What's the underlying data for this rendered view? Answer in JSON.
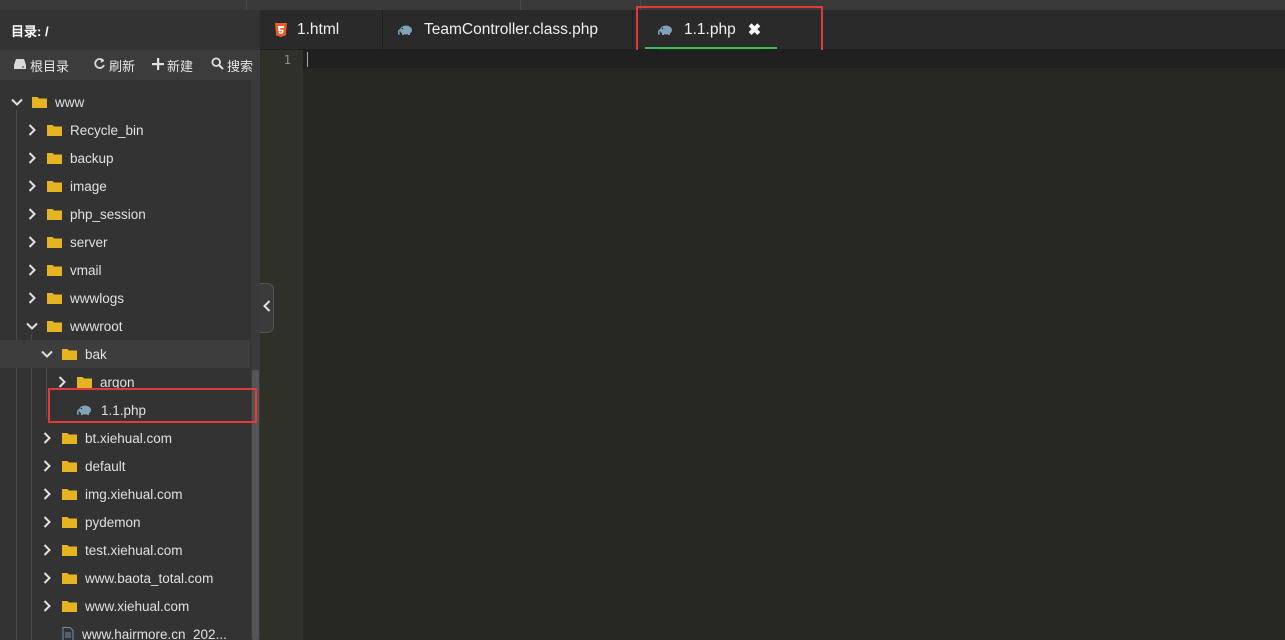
{
  "sidebar": {
    "directory_label": "目录: /",
    "toolbar": {
      "root": "根目录",
      "refresh": "刷新",
      "new": "新建",
      "search": "搜索"
    },
    "tree": [
      {
        "label": "www",
        "depth": 0,
        "type": "folder",
        "expanded": true
      },
      {
        "label": "Recycle_bin",
        "depth": 1,
        "type": "folder",
        "expanded": false
      },
      {
        "label": "backup",
        "depth": 1,
        "type": "folder",
        "expanded": false
      },
      {
        "label": "image",
        "depth": 1,
        "type": "folder",
        "expanded": false
      },
      {
        "label": "php_session",
        "depth": 1,
        "type": "folder",
        "expanded": false
      },
      {
        "label": "server",
        "depth": 1,
        "type": "folder",
        "expanded": false
      },
      {
        "label": "vmail",
        "depth": 1,
        "type": "folder",
        "expanded": false
      },
      {
        "label": "wwwlogs",
        "depth": 1,
        "type": "folder",
        "expanded": false
      },
      {
        "label": "wwwroot",
        "depth": 1,
        "type": "folder",
        "expanded": true
      },
      {
        "label": "bak",
        "depth": 2,
        "type": "folder",
        "expanded": true,
        "selected": true
      },
      {
        "label": "argon",
        "depth": 3,
        "type": "folder",
        "expanded": false
      },
      {
        "label": "1.1.php",
        "depth": 3,
        "type": "php"
      },
      {
        "label": "bt.xiehual.com",
        "depth": 2,
        "type": "folder",
        "expanded": false
      },
      {
        "label": "default",
        "depth": 2,
        "type": "folder",
        "expanded": false
      },
      {
        "label": "img.xiehual.com",
        "depth": 2,
        "type": "folder",
        "expanded": false
      },
      {
        "label": "pydemon",
        "depth": 2,
        "type": "folder",
        "expanded": false
      },
      {
        "label": "test.xiehual.com",
        "depth": 2,
        "type": "folder",
        "expanded": false
      },
      {
        "label": "www.baota_total.com",
        "depth": 2,
        "type": "folder",
        "expanded": false
      },
      {
        "label": "www.xiehual.com",
        "depth": 2,
        "type": "folder",
        "expanded": false
      },
      {
        "label": "www.hairmore.cn_202...",
        "depth": 2,
        "type": "file"
      }
    ]
  },
  "editor": {
    "tabs": [
      {
        "label": "1.html",
        "icon": "html5-icon"
      },
      {
        "label": "TeamController.class.php",
        "icon": "php-elephant-icon"
      },
      {
        "label": "1.1.php",
        "icon": "php-elephant-icon",
        "active": true,
        "close": "✖"
      }
    ],
    "line_numbers": [
      "1"
    ]
  },
  "colors": {
    "folder": "#e6b422",
    "php_icon": "#7fa3b8",
    "html5_icon": "#e65c2b",
    "highlight": "#e23a3a",
    "active_tab_underline": "#3fb950",
    "editor_bg": "#272822"
  }
}
